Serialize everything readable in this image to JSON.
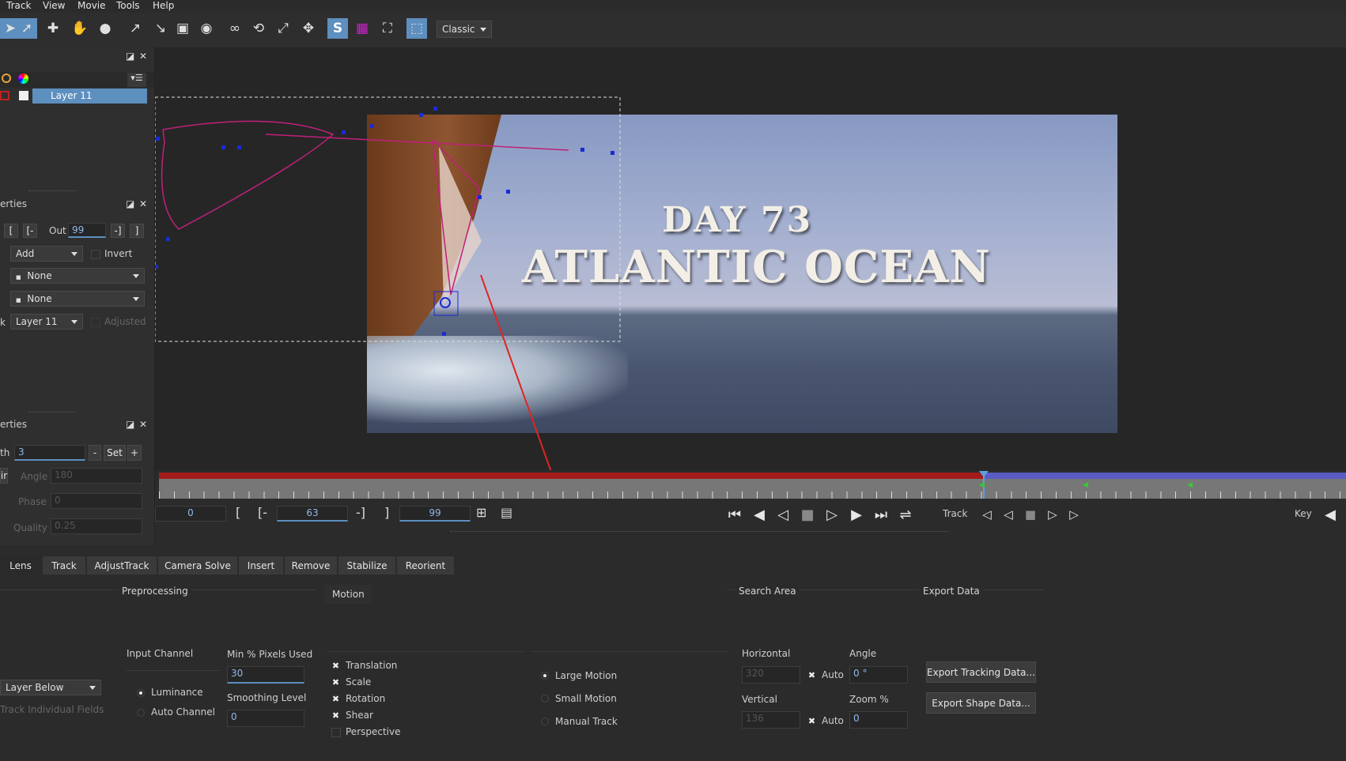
{
  "menu": [
    "Track",
    "View",
    "Movie",
    "Tools",
    "Help"
  ],
  "toolbar": {
    "view_mode": "Classic"
  },
  "layers_panel": {
    "layer_name": "Layer 11"
  },
  "clip_properties": {
    "title": "erties",
    "out_label": "Out",
    "out_value": "99",
    "blend_mode": "Add",
    "invert_label": "Invert",
    "matte_a": "None",
    "matte_b": "None",
    "track_prefix": "k",
    "track_layer": "Layer 11",
    "adjusted_label": "Adjusted"
  },
  "shape_properties": {
    "title": "erties",
    "width_prefix": "th",
    "width_value": "3",
    "minus_label": "-",
    "set_label": "Set",
    "plus_label": "+",
    "color_prefix": "ir",
    "angle_label": "Angle",
    "angle_value": "180",
    "phase_label": "Phase",
    "phase_value": "0",
    "quality_label": "Quality",
    "quality_value": "0.25"
  },
  "viewer": {
    "caption_line1": "DAY 73",
    "caption_line2": "ATLANTIC OCEAN"
  },
  "transport": {
    "current_frame": "0",
    "in_frame": "63",
    "out_frame": "99",
    "track_label": "Track",
    "key_label": "Key"
  },
  "tabs": [
    "Lens",
    "Track",
    "AdjustTrack",
    "Camera Solve",
    "Insert",
    "Remove",
    "Stabilize",
    "Reorient"
  ],
  "track_tab": {
    "preprocessing_title": "Preprocessing",
    "motion_title": "Motion",
    "search_area_title": "Search Area",
    "export_title": "Export Data",
    "input_channel_label": "Input Channel",
    "input_channel_value": "Layer Below",
    "channel_luminance": "Luminance",
    "channel_auto": "Auto Channel",
    "track_fields_label": "Track Individual Fields",
    "min_pixels_label": "Min % Pixels Used",
    "min_pixels_value": "30",
    "smoothing_label": "Smoothing Level",
    "smoothing_value": "0",
    "motion_options": [
      "Translation",
      "Scale",
      "Rotation",
      "Shear",
      "Perspective"
    ],
    "motion_checked": [
      true,
      true,
      true,
      true,
      false
    ],
    "motion_modes": [
      "Large Motion",
      "Small Motion",
      "Manual Track"
    ],
    "horizontal_label": "Horizontal",
    "horizontal_value": "320",
    "vertical_label": "Vertical",
    "vertical_value": "136",
    "auto_label_1": "Auto",
    "auto_label_2": "Auto",
    "angle_label": "Angle",
    "angle_value": "0 °",
    "zoom_label": "Zoom %",
    "zoom_value": "0",
    "export_tracking_btn": "Export Tracking Data...",
    "export_shape_btn": "Export Shape Data..."
  },
  "colors": {
    "accent": "#5d8fbf",
    "spline": "#c0207a",
    "timeline_red": "#a41b1b",
    "timeline_blue": "#5b5bc4"
  }
}
